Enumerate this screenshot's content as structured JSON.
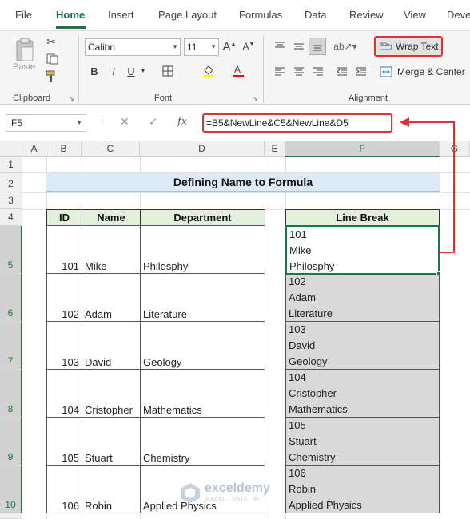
{
  "ribbon": {
    "tabs": [
      "File",
      "Home",
      "Insert",
      "Page Layout",
      "Formulas",
      "Data",
      "Review",
      "View",
      "Deve"
    ],
    "active_tab": "Home",
    "clipboard": {
      "paste_label": "Paste",
      "group_label": "Clipboard"
    },
    "font": {
      "name": "Calibri",
      "size": "11",
      "group_label": "Font",
      "bold": "B",
      "italic": "I",
      "underline": "U"
    },
    "alignment": {
      "wrap_text_label": "Wrap Text",
      "merge_center_label": "Merge & Center",
      "group_label": "Alignment"
    }
  },
  "formula_bar": {
    "name_box": "F5",
    "fx": "fx",
    "formula": "=B5&NewLine&C5&NewLine&D5"
  },
  "columns": [
    "A",
    "B",
    "C",
    "D",
    "E",
    "F",
    "G"
  ],
  "rows": [
    "1",
    "2",
    "3",
    "4",
    "5",
    "6",
    "7",
    "8",
    "9",
    "10"
  ],
  "sheet": {
    "title": "Defining Name to Formula",
    "headers": {
      "id": "ID",
      "name": "Name",
      "department": "Department",
      "line_break": "Line Break"
    },
    "records": [
      {
        "id": "101",
        "name": "Mike",
        "department": "Philosphy"
      },
      {
        "id": "102",
        "name": "Adam",
        "department": "Literature"
      },
      {
        "id": "103",
        "name": "David",
        "department": "Geology"
      },
      {
        "id": "104",
        "name": "Cristopher",
        "department": "Mathematics"
      },
      {
        "id": "105",
        "name": "Stuart",
        "department": "Chemistry"
      },
      {
        "id": "106",
        "name": "Robin",
        "department": "Applied Physics"
      }
    ]
  },
  "watermark": {
    "name": "exceldemy",
    "tagline": "EXCEL · DATA · BI"
  },
  "colors": {
    "accent": "#217346",
    "highlight": "#e03232",
    "title_fill": "#deebf7",
    "header_fill": "#e2efda",
    "result_fill": "#d9d9d9"
  }
}
